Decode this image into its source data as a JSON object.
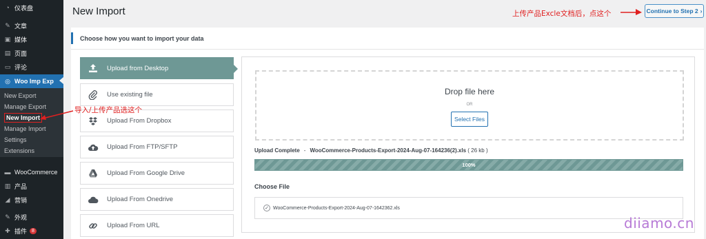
{
  "sidebar": {
    "items": [
      {
        "label": "仪表盘",
        "icon": "dashboard-icon",
        "glyph": "◔"
      },
      {
        "label": "文章",
        "icon": "pin-icon",
        "glyph": "✎"
      },
      {
        "label": "媒体",
        "icon": "media-icon",
        "glyph": "▣"
      },
      {
        "label": "页面",
        "icon": "pages-icon",
        "glyph": "▤"
      },
      {
        "label": "评论",
        "icon": "comments-icon",
        "glyph": "▭"
      },
      {
        "label": "Woo Imp Exp",
        "icon": "woo-imp-exp-icon",
        "glyph": "◎"
      },
      {
        "label": "WooCommerce",
        "icon": "woocommerce-icon",
        "glyph": "▬"
      },
      {
        "label": "产品",
        "icon": "products-icon",
        "glyph": "▥"
      },
      {
        "label": "营销",
        "icon": "marketing-icon",
        "glyph": "◢"
      },
      {
        "label": "外观",
        "icon": "appearance-icon",
        "glyph": "✎"
      },
      {
        "label": "插件",
        "icon": "plugins-icon",
        "glyph": "✚",
        "badge": "8"
      }
    ],
    "submenu": [
      "New Export",
      "Manage Export",
      "New Import",
      "Manage Import",
      "Settings",
      "Extensions"
    ]
  },
  "header": {
    "title": "New Import",
    "continue_label": "Continue to Step 2",
    "continue_glyph": "›"
  },
  "panel": {
    "heading": "Choose how you want to import your data",
    "options": [
      {
        "label": "Upload from Desktop",
        "icon": "upload-icon",
        "active": true
      },
      {
        "label": "Use existing file",
        "icon": "paperclip-icon"
      },
      {
        "label": "Upload From Dropbox",
        "icon": "dropbox-icon"
      },
      {
        "label": "Upload From FTP/SFTP",
        "icon": "cloud-upload-icon"
      },
      {
        "label": "Upload From Google Drive",
        "icon": "google-drive-icon"
      },
      {
        "label": "Upload From Onedrive",
        "icon": "cloud-icon"
      },
      {
        "label": "Upload From URL",
        "icon": "link-icon"
      }
    ]
  },
  "dropzone": {
    "title": "Drop file here",
    "or": "OR",
    "select_label": "Select Files"
  },
  "upload": {
    "status": "Upload Complete",
    "dash": "-",
    "filename": "WooCommerce-Products-Export-2024-Aug-07-164236(2).xls",
    "size": "( 26 kb )",
    "progress_text": "100%",
    "progress": 1.0
  },
  "choose_file": {
    "title": "Choose File",
    "file": "WooCommerce-Products-Export-2024-Aug-07-1642362.xls",
    "check": "✓"
  },
  "annotations": {
    "step2_note": "上传产品Excle文档后，点这个",
    "import_note": "导入/上传产品选这个",
    "watermark": "diiamo.cn",
    "color": "#e02020"
  }
}
